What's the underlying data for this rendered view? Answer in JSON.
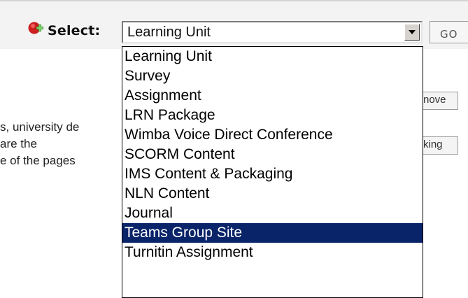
{
  "toolbar": {
    "add_icon": "red-circle-plus-icon",
    "select_label": "Select:",
    "select_value": "Learning Unit",
    "go_label": "GO"
  },
  "background": {
    "text_lines": [
      "s, university de",
      "are the",
      "e of the pages"
    ],
    "buttons": [
      {
        "label": "nove"
      },
      {
        "label": "king"
      }
    ]
  },
  "dropdown": {
    "options": [
      {
        "label": "Learning Unit"
      },
      {
        "label": "Survey"
      },
      {
        "label": "Assignment"
      },
      {
        "label": "LRN Package"
      },
      {
        "label": "Wimba Voice Direct Conference"
      },
      {
        "label": "SCORM Content"
      },
      {
        "label": "IMS Content & Packaging"
      },
      {
        "label": "NLN Content"
      },
      {
        "label": "Journal"
      },
      {
        "label": "Teams Group Site"
      },
      {
        "label": "Turnitin Assignment"
      }
    ],
    "highlighted": "Teams Group Site",
    "highlight_color": "#0a246a"
  }
}
